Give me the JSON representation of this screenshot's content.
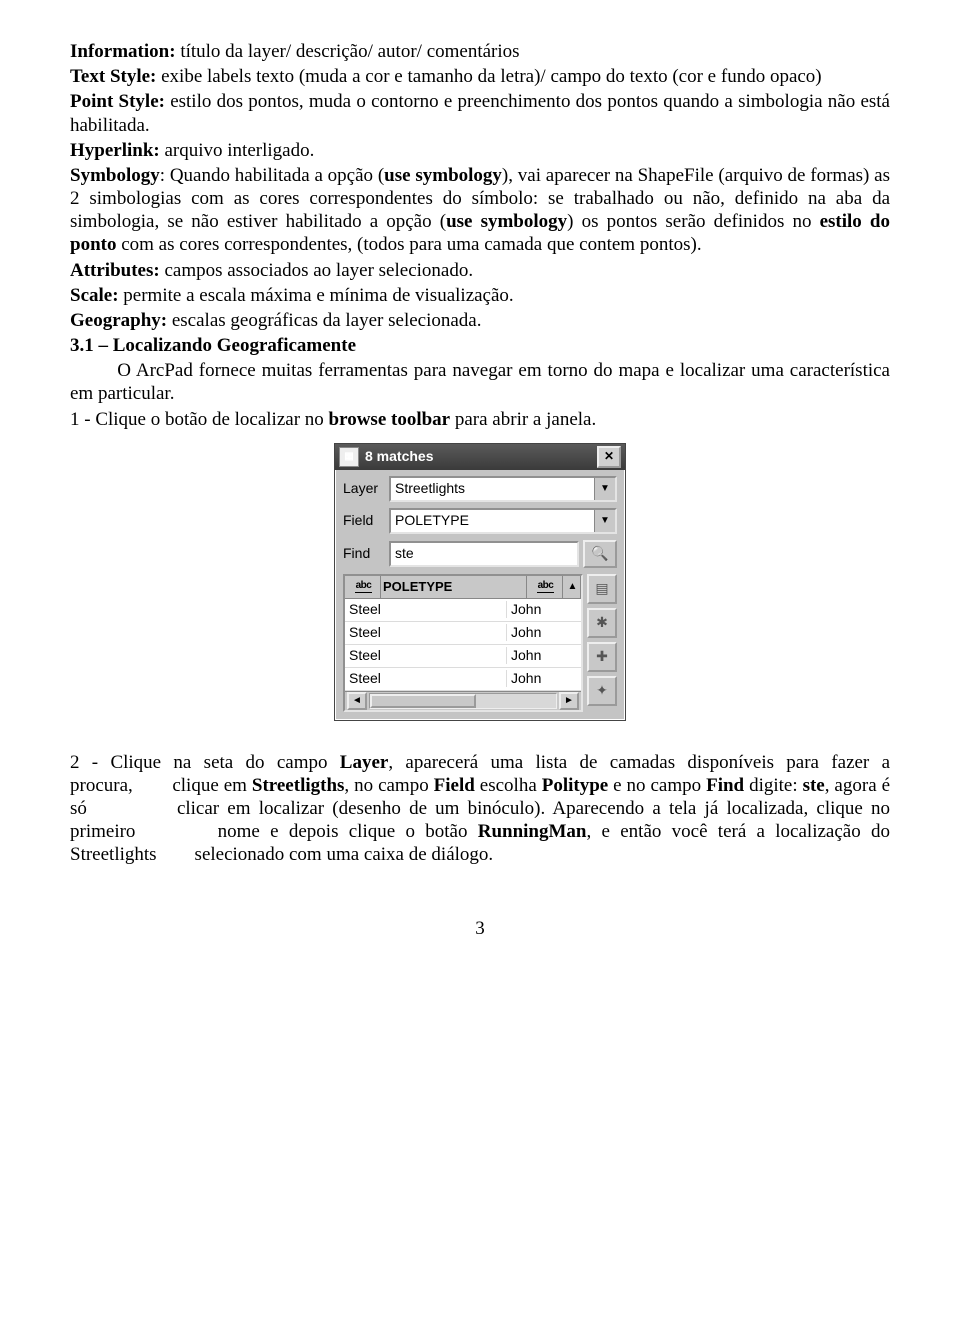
{
  "body": {
    "p1": {
      "label": "Information:",
      "text": " título da layer/ descrição/ autor/ comentários"
    },
    "p2": {
      "label": "Text Style:",
      "text": " exibe labels texto (muda a cor e tamanho da letra)/ campo do texto (cor e fundo opaco)"
    },
    "p3": {
      "label": "Point Style:",
      "text": " estilo dos pontos, muda o contorno e preenchimento dos pontos quando a simbologia não está habilitada."
    },
    "p4": {
      "label": "Hyperlink:",
      "text": " arquivo interligado."
    },
    "p5": {
      "label": "Symbology",
      "t1": ": Quando habilitada a opção (",
      "b1": "use symbology",
      "t2": "), vai aparecer na ShapeFile (arquivo de formas) as 2 simbologias com as cores correspondentes do símbolo: se trabalhado ou não, definido na aba da simbologia, se não estiver habilitado a opção (",
      "b2": "use symbology",
      "t3": ") os pontos serão definidos no ",
      "b3": "estilo do ponto",
      "t4": " com as cores correspondentes, (todos para uma camada que contem pontos)."
    },
    "p6": {
      "label": "Attributes:",
      "text": " campos associados ao layer selecionado."
    },
    "p7": {
      "label": "Scale:",
      "text": " permite a escala máxima e mínima de visualização."
    },
    "p8": {
      "label": "Geography:",
      "text": " escalas geográficas da layer selecionada."
    },
    "sec31": " 3.1 – Localizando Geograficamente",
    "p9": {
      "t1": "        O ArcPad fornece muitas ferramentas para navegar em torno do mapa e  localizar uma característica em particular."
    },
    "p10": {
      "t1": "1 - Clique o botão de localizar no ",
      "b1": "browse toolbar",
      "t2": " para abrir a janela."
    },
    "p11": {
      "t1": "2 - Clique na seta do campo ",
      "b1": "Layer",
      "t2": ", aparecerá uma lista de camadas disponíveis para fazer a procura,        clique em ",
      "b2": "Streetligths",
      "t3": ", no campo ",
      "b3": "Field",
      "t4": " escolha ",
      "b4": "Politype",
      "t5": " e no campo ",
      "b5": "Find",
      "t6": " digite: ",
      "b6": "ste",
      "t7": ", agora é só           clicar em localizar (desenho de um binóculo). Aparecendo a tela já localizada, clique no primeiro        nome e depois clique o botão ",
      "b7": "RunningMan",
      "t8": ", e então você terá a localização do Streetlights        selecionado com uma caixa de diálogo."
    }
  },
  "dialog": {
    "title": "8 matches",
    "labels": {
      "layer": "Layer",
      "field": "Field",
      "find": "Find"
    },
    "values": {
      "layer": "Streetlights",
      "field": "POLETYPE",
      "find": " ste"
    },
    "header": {
      "abc": "abc",
      "col": "POLETYPE",
      "sort": "▲"
    },
    "rows": [
      {
        "c1": "Steel",
        "c2": "John"
      },
      {
        "c1": "Steel",
        "c2": "John"
      },
      {
        "c1": "Steel",
        "c2": "John"
      },
      {
        "c1": "Steel",
        "c2": "John"
      }
    ],
    "icons": {
      "close": "✕",
      "dropdown": "▼",
      "binoculars": "🔍",
      "leftArrow": "◄",
      "rightArrow": "►",
      "sideProps": "▤",
      "sideRun": "✱",
      "sideAdd": "✚",
      "sideFlash": "✦"
    }
  },
  "page_number": "3"
}
